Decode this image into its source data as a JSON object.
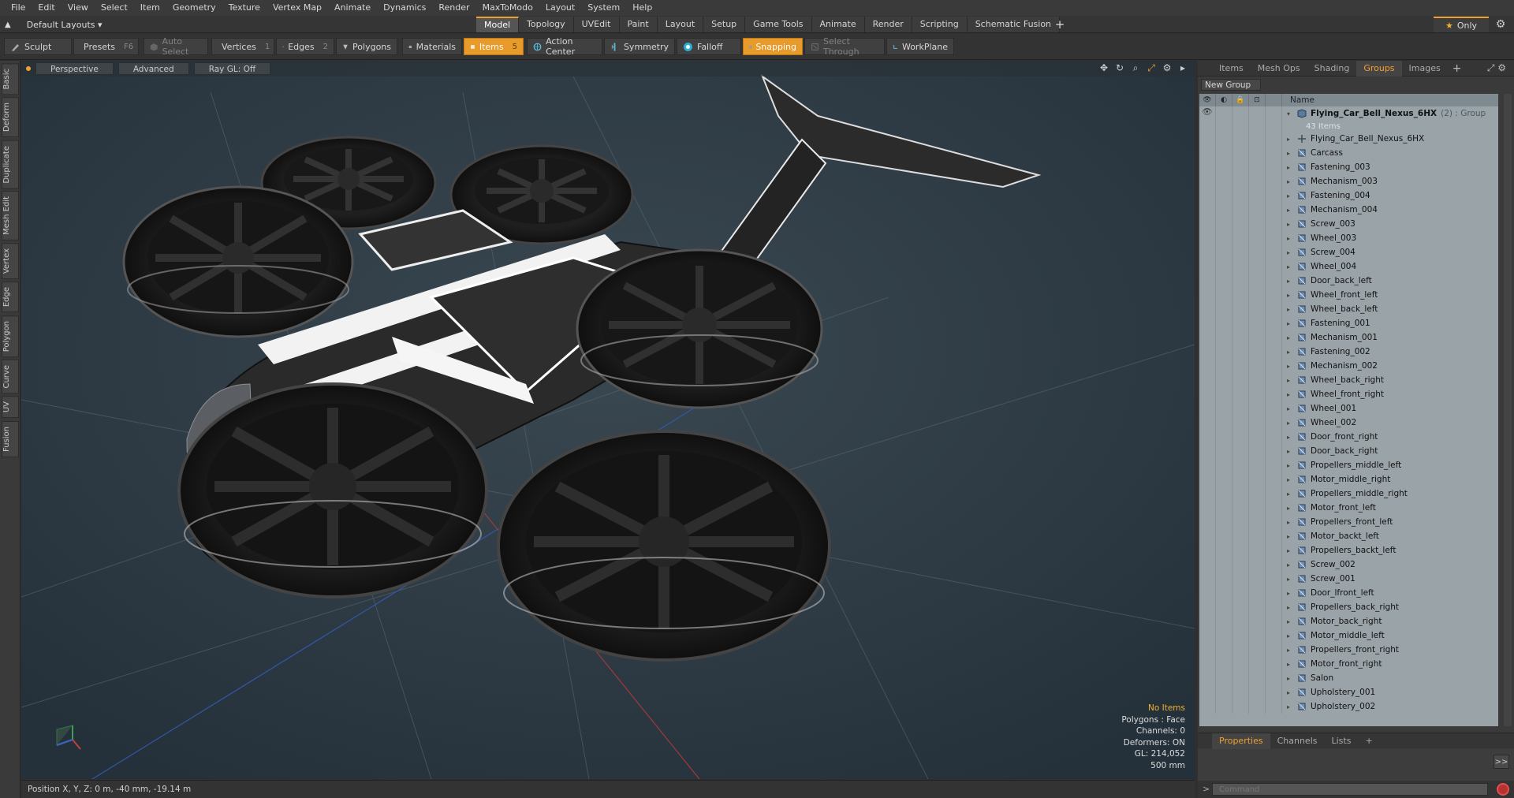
{
  "menu": [
    "File",
    "Edit",
    "View",
    "Select",
    "Item",
    "Geometry",
    "Texture",
    "Vertex Map",
    "Animate",
    "Dynamics",
    "Render",
    "MaxToModo",
    "Layout",
    "System",
    "Help"
  ],
  "layout": {
    "selector": "Default Layouts ▾"
  },
  "tabs": [
    {
      "label": "Model",
      "active": true
    },
    {
      "label": "Topology"
    },
    {
      "label": "UVEdit"
    },
    {
      "label": "Paint"
    },
    {
      "label": "Layout"
    },
    {
      "label": "Setup"
    },
    {
      "label": "Game Tools"
    },
    {
      "label": "Animate"
    },
    {
      "label": "Render"
    },
    {
      "label": "Scripting"
    },
    {
      "label": "Schematic Fusion"
    }
  ],
  "only_label": "Only",
  "toolbar": {
    "sculpt": "Sculpt",
    "presets": "Presets",
    "presets_key": "F6",
    "auto_select": "Auto Select",
    "vertices": "Vertices",
    "vertices_num": "1",
    "edges": "Edges",
    "edges_num": "2",
    "polygons": "Polygons",
    "materials": "Materials",
    "items": "Items",
    "items_num": "5",
    "action_center": "Action Center",
    "symmetry": "Symmetry",
    "falloff": "Falloff",
    "snapping": "Snapping",
    "select_through": "Select Through",
    "workplane": "WorkPlane"
  },
  "left_tabs": [
    "Basic",
    "Deform",
    "Duplicate",
    "Mesh Edit",
    "Vertex",
    "Edge",
    "Polygon",
    "Curve",
    "UV",
    "Fusion"
  ],
  "viewport": {
    "view": "Perspective",
    "shading": "Advanced",
    "raygl": "Ray GL: Off"
  },
  "stats": {
    "selection": "No Items",
    "polygons": "Polygons : Face",
    "channels": "Channels: 0",
    "deformers": "Deformers: ON",
    "gl": "GL: 214,052",
    "scale": "500 mm"
  },
  "status": "Position X, Y, Z:  0 m, -40 mm, -19.14 m",
  "right_tabs": [
    "Items",
    "Mesh Ops",
    "Shading",
    "Groups",
    "Images"
  ],
  "right_active": "Groups",
  "new_group": "New Group",
  "tree": {
    "col_name": "Name",
    "group_name": "Flying_Car_Bell_Nexus_6HX",
    "group_tag": "(2) : Group",
    "group_count": "43 Items",
    "items": [
      "Flying_Car_Bell_Nexus_6HX",
      "Carcass",
      "Fastening_003",
      "Mechanism_003",
      "Fastening_004",
      "Mechanism_004",
      "Screw_003",
      "Wheel_003",
      "Screw_004",
      "Wheel_004",
      "Door_back_left",
      "Wheel_front_left",
      "Wheel_back_left",
      "Fastening_001",
      "Mechanism_001",
      "Fastening_002",
      "Mechanism_002",
      "Wheel_back_right",
      "Wheel_front_right",
      "Wheel_001",
      "Wheel_002",
      "Door_front_right",
      "Door_back_right",
      "Propellers_middle_left",
      "Motor_middle_right",
      "Propellers_middle_right",
      "Motor_front_left",
      "Propellers_front_left",
      "Motor_backt_left",
      "Propellers_backt_left",
      "Screw_002",
      "Screw_001",
      "Door_lfront_left",
      "Propellers_back_right",
      "Motor_back_right",
      "Motor_middle_left",
      "Propellers_front_right",
      "Motor_front_right",
      "Salon",
      "Upholstery_001",
      "Upholstery_002"
    ]
  },
  "props_tabs": [
    "Properties",
    "Channels",
    "Lists"
  ],
  "props_active": "Properties",
  "command_placeholder": "Command",
  "colors": {
    "accent": "#f0a030",
    "tree_bg": "#9aa3a8",
    "viewport_bg": "#2d3a43"
  }
}
